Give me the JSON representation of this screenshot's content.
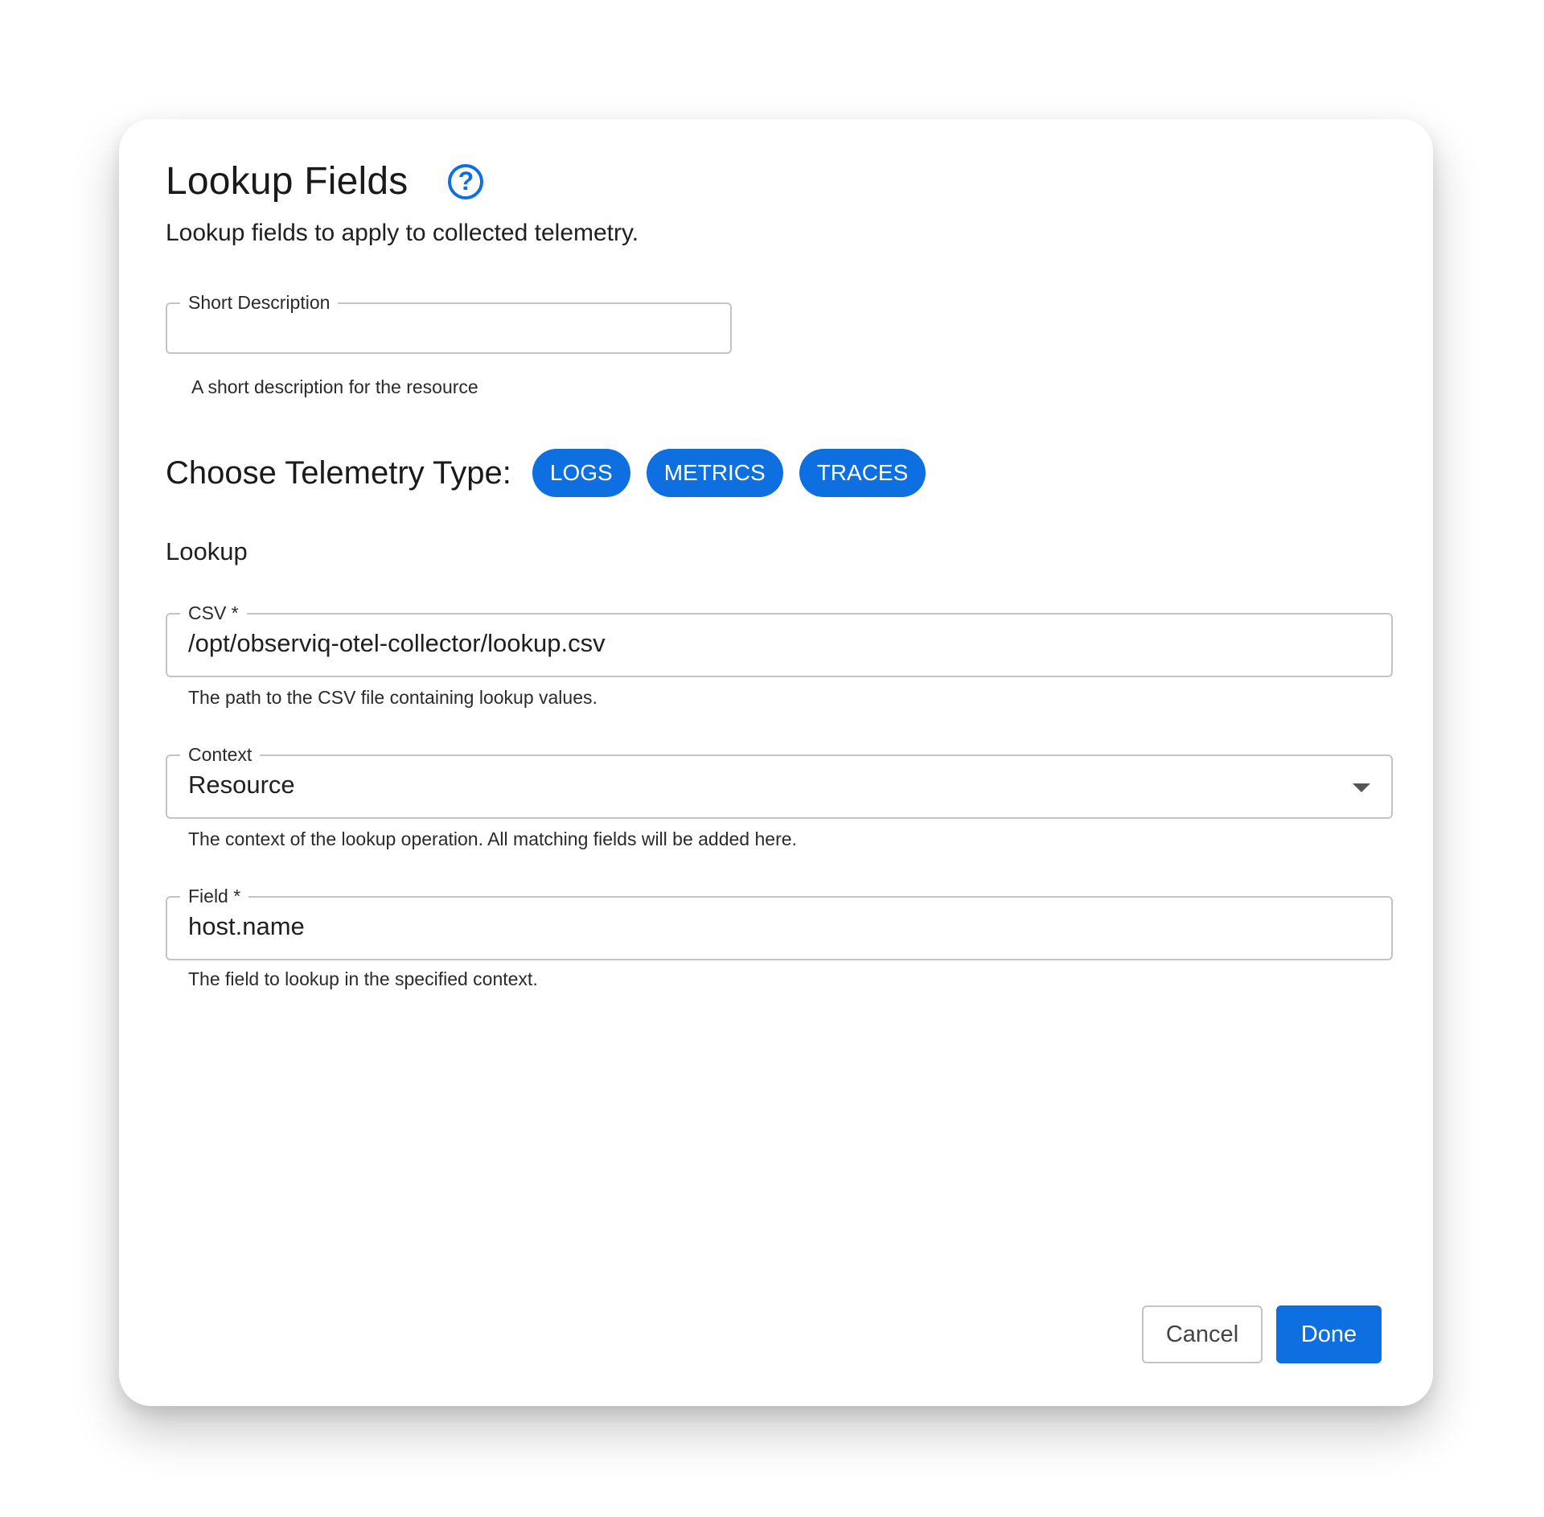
{
  "dialog": {
    "title": "Lookup Fields",
    "help_icon": "question-circle-icon",
    "subtitle": "Lookup fields to apply to collected telemetry."
  },
  "short_description": {
    "label": "Short Description",
    "value": "",
    "helper": "A short description for the resource"
  },
  "telemetry": {
    "label": "Choose Telemetry Type:",
    "chips": [
      "LOGS",
      "METRICS",
      "TRACES"
    ]
  },
  "lookup": {
    "heading": "Lookup",
    "csv": {
      "label": "CSV *",
      "value": "/opt/observiq-otel-collector/lookup.csv",
      "helper": "The path to the CSV file containing lookup values."
    },
    "context": {
      "label": "Context",
      "value": "Resource",
      "helper": "The context of the lookup operation. All matching fields will be added here."
    },
    "field": {
      "label": "Field *",
      "value": "host.name",
      "helper": "The field to lookup in the specified context."
    }
  },
  "actions": {
    "cancel": "Cancel",
    "done": "Done"
  },
  "colors": {
    "accent": "#0d6fe0",
    "border": "#c4c4c4"
  }
}
